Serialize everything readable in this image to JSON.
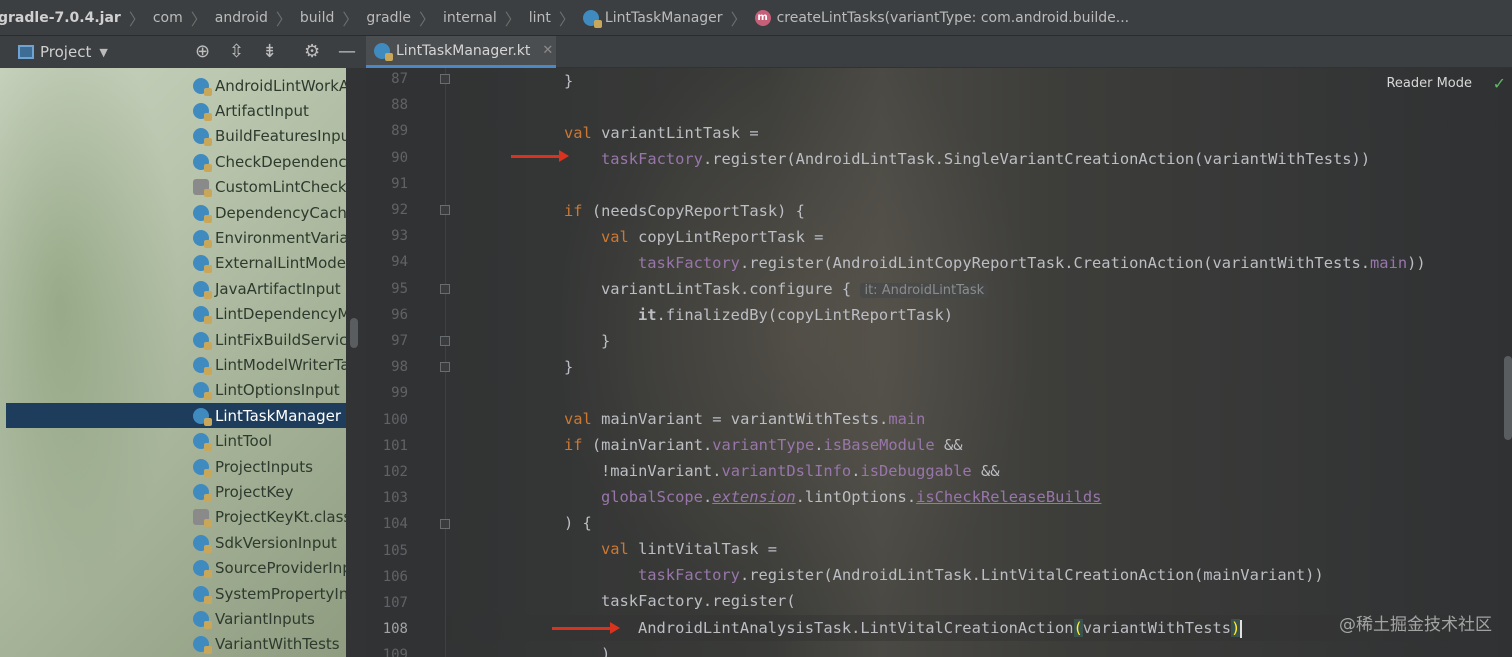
{
  "breadcrumb": {
    "items": [
      "gradle-7.0.4.jar",
      "com",
      "android",
      "build",
      "gradle",
      "internal",
      "lint"
    ],
    "class_name": "LintTaskManager",
    "method": "createLintTasks(variantType: com.android.builde..."
  },
  "project_panel": {
    "title": "Project",
    "items": [
      {
        "label": "AndroidLintWorkA"
      },
      {
        "label": "ArtifactInput"
      },
      {
        "label": "BuildFeaturesInpu"
      },
      {
        "label": "CheckDependenci"
      },
      {
        "label": "CustomLintCheck"
      },
      {
        "label": "DependencyCache"
      },
      {
        "label": "EnvironmentVaria"
      },
      {
        "label": "ExternalLintMode"
      },
      {
        "label": "JavaArtifactInput"
      },
      {
        "label": "LintDependencyM"
      },
      {
        "label": "LintFixBuildServic"
      },
      {
        "label": "LintModelWriterTa"
      },
      {
        "label": "LintOptionsInput"
      },
      {
        "label": "LintTaskManager"
      },
      {
        "label": "LintTool"
      },
      {
        "label": "ProjectInputs"
      },
      {
        "label": "ProjectKey"
      },
      {
        "label": "ProjectKeyKt.class"
      },
      {
        "label": "SdkVersionInput"
      },
      {
        "label": "SourceProviderInp"
      },
      {
        "label": "SystemPropertyIn"
      },
      {
        "label": "VariantInputs"
      },
      {
        "label": "VariantWithTests"
      }
    ],
    "selected": "LintTaskManager"
  },
  "editor": {
    "tab_label": "LintTaskManager.kt",
    "reader_mode": "Reader Mode",
    "current_line": "108",
    "line_numbers": [
      "87",
      "88",
      "89",
      "90",
      "91",
      "92",
      "93",
      "94",
      "95",
      "96",
      "97",
      "98",
      "99",
      "100",
      "101",
      "102",
      "103",
      "104",
      "105",
      "106",
      "107",
      "108",
      "109"
    ],
    "inlay_hint": "it: AndroidLintTask",
    "code": {
      "l87": "}",
      "l89_kw": "val",
      "l89_rest": " variantLintTask =",
      "l90_a": "taskFactory",
      "l90_b": ".register(AndroidLintTask.SingleVariantCreationAction(variantWithTests))",
      "l92_kw": "if",
      "l92_rest": " (needsCopyReportTask) {",
      "l93_kw": "val",
      "l93_rest": " copyLintReportTask =",
      "l94_a": "taskFactory",
      "l94_b": ".register(AndroidLintCopyReportTask.CreationAction(variantWithTests.",
      "l94_c": "main",
      "l94_d": "))",
      "l95": "variantLintTask.configure {",
      "l96_a": "it",
      "l96_b": ".finalizedBy(copyLintReportTask)",
      "l97": "}",
      "l98": "}",
      "l100_kw": "val",
      "l100_a": " mainVariant = variantWithTests.",
      "l100_b": "main",
      "l101_kw": "if",
      "l101_a": " (mainVariant.",
      "l101_b": "variantType",
      "l101_c": ".",
      "l101_d": "isBaseModule",
      "l101_e": " &&",
      "l102_a": "!mainVariant.",
      "l102_b": "variantDslInfo",
      "l102_c": ".",
      "l102_d": "isDebuggable",
      "l102_e": " &&",
      "l103_a": "globalScope",
      "l103_b": ".",
      "l103_c": "extension",
      "l103_d": ".lintOptions.",
      "l103_e": "isCheckReleaseBuilds",
      "l104": ") {",
      "l105_kw": "val",
      "l105_rest": " lintVitalTask =",
      "l106_a": "taskFactory",
      "l106_b": ".register(AndroidLintTask.LintVitalCreationAction(mainVariant))",
      "l107": "taskFactory.register(",
      "l108_a": "AndroidLintAnalysisTask.LintVitalCreationAction",
      "l108_b": "(",
      "l108_c": "variantWithTests",
      "l108_d": ")",
      "l109": ")"
    }
  },
  "watermark": "@稀土掘金技术社区"
}
